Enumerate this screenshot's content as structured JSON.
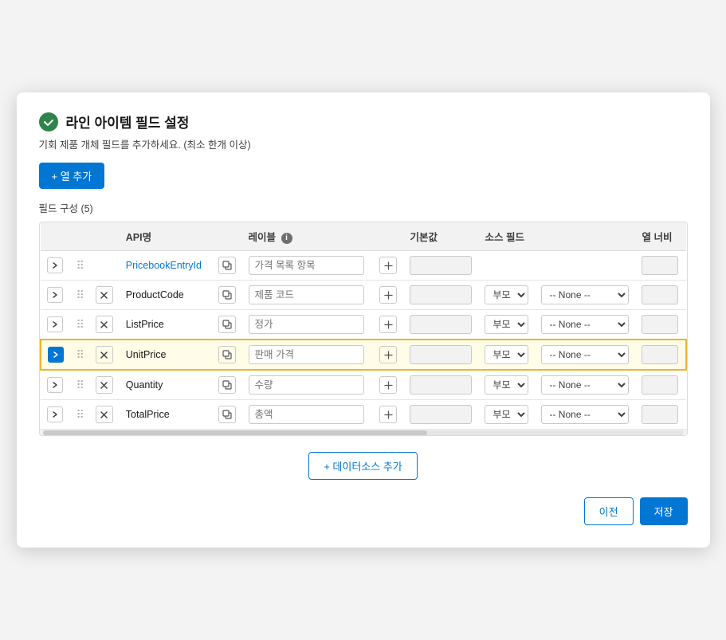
{
  "modal": {
    "title": "라인 아이템 필드 설정",
    "subtitle": "기회 제품 개체 필드를 추가하세요. (최소 한개 이상)",
    "add_col_btn": "+ 열 추가",
    "field_count_label": "필드 구성 (5)",
    "add_datasource_btn": "+ 데이터소스 추가",
    "prev_btn": "이전",
    "save_btn": "저장"
  },
  "table": {
    "headers": [
      "",
      "",
      "",
      "API명",
      "",
      "레이블",
      "",
      "기본값",
      "소스 필드",
      "",
      "열 너비"
    ],
    "col_label_info": "레이블",
    "rows": [
      {
        "id": "row-1",
        "expand": true,
        "is_lookup": true,
        "api_name": "PricebookEntryId",
        "api_name_is_link": true,
        "label_placeholder": "가격 목록 항목",
        "label_value": "",
        "default_value": "",
        "source_parent": "",
        "source_field": "",
        "width": "",
        "highlighted": false,
        "source_disabled": true
      },
      {
        "id": "row-2",
        "expand": false,
        "is_lookup": false,
        "api_name": "ProductCode",
        "api_name_is_link": false,
        "label_placeholder": "제품 코드",
        "label_value": "",
        "default_value": "",
        "source_parent": "부모",
        "source_field": "-- None --",
        "width": "",
        "highlighted": false
      },
      {
        "id": "row-3",
        "expand": false,
        "is_lookup": false,
        "api_name": "ListPrice",
        "api_name_is_link": false,
        "label_placeholder": "정가",
        "label_value": "",
        "default_value": "",
        "source_parent": "부모",
        "source_field": "-- None --",
        "width": "",
        "highlighted": false
      },
      {
        "id": "row-4",
        "expand": false,
        "is_lookup": false,
        "api_name": "UnitPrice",
        "api_name_is_link": false,
        "label_placeholder": "판매 가격",
        "label_value": "",
        "default_value": "",
        "source_parent": "부모",
        "source_field": "-- None --",
        "width": "",
        "highlighted": true
      },
      {
        "id": "row-5",
        "expand": false,
        "is_lookup": false,
        "api_name": "Quantity",
        "api_name_is_link": false,
        "label_placeholder": "수량",
        "label_value": "",
        "default_value": "",
        "source_parent": "부모",
        "source_field": "-- None --",
        "width": "",
        "highlighted": false
      },
      {
        "id": "row-6",
        "expand": false,
        "is_lookup": false,
        "api_name": "TotalPrice",
        "api_name_is_link": false,
        "label_placeholder": "총액",
        "label_value": "",
        "default_value": "",
        "source_parent": "부모",
        "source_field": "-- None --",
        "width": "",
        "highlighted": false
      }
    ],
    "source_parent_options": [
      "부모"
    ],
    "source_field_options": [
      "-- None --"
    ]
  }
}
